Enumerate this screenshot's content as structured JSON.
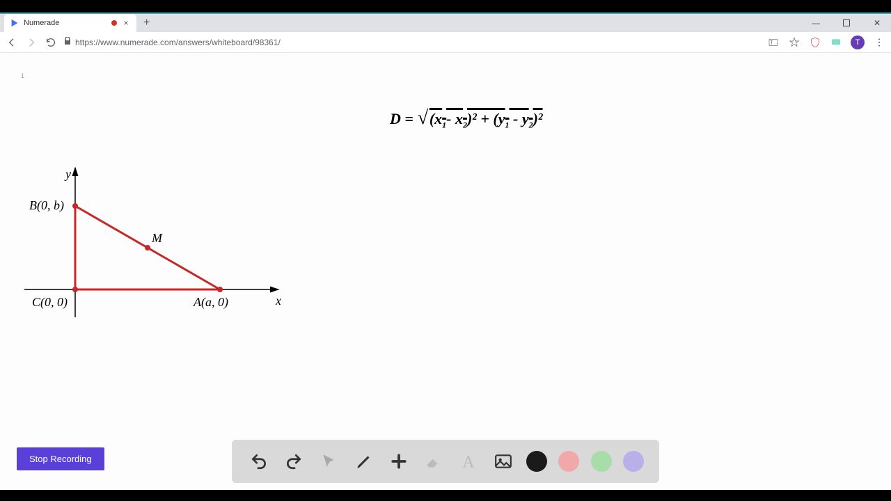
{
  "tab": {
    "title": "Numerade"
  },
  "url": "https://www.numerade.com/answers/whiteboard/98361/",
  "page_counter": "1",
  "graph": {
    "y_label": "y",
    "x_label": "x",
    "points": {
      "B": "B(0, b)",
      "C": "C(0, 0)",
      "A": "A(a, 0)",
      "M": "M"
    }
  },
  "formula": "D = √(x₁- x₂)² + (y₁ - y₂)²",
  "stop_button": "Stop Recording",
  "avatar_letter": "T",
  "colors": {
    "black": "#1a1a1a",
    "red": "#f0a8a8",
    "green": "#a8dca8",
    "purple": "#b8b0e8"
  }
}
